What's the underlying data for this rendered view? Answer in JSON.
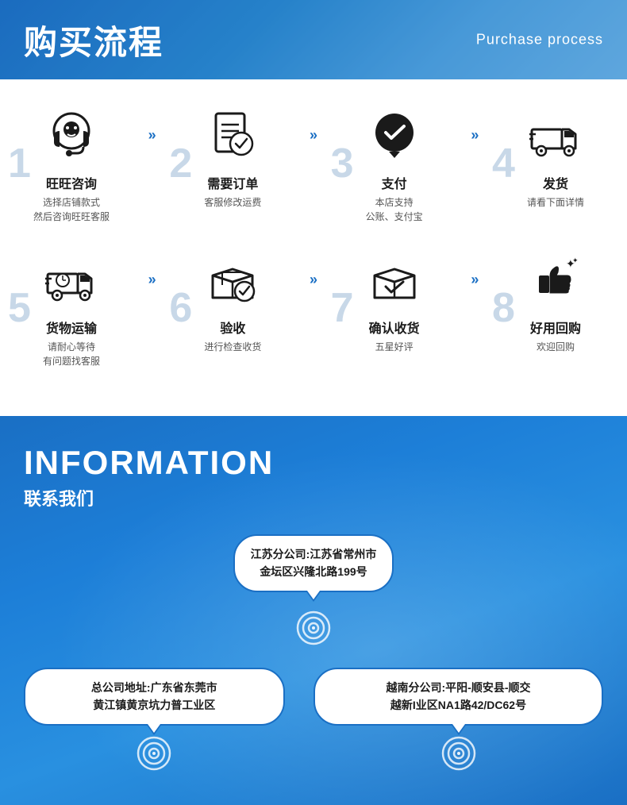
{
  "header": {
    "title_cn": "购买流程",
    "title_en": "Purchase process",
    "bg_color": "#1a7cd4"
  },
  "steps_row1": [
    {
      "number": "1",
      "title": "旺旺咨询",
      "desc": "选择店铺款式\n然后咨询旺旺客服",
      "icon": "headset"
    },
    {
      "number": "2",
      "title": "需要订单",
      "desc": "客服修改运费",
      "icon": "document"
    },
    {
      "number": "3",
      "title": "支付",
      "desc": "本店支持\n公账、支付宝",
      "icon": "chat-check"
    },
    {
      "number": "4",
      "title": "发货",
      "desc": "请看下面详情",
      "icon": "delivery"
    }
  ],
  "steps_row2": [
    {
      "number": "5",
      "title": "货物运输",
      "desc": "请耐心等待\n有问题找客服",
      "icon": "truck-clock"
    },
    {
      "number": "6",
      "title": "验收",
      "desc": "进行检查收货",
      "icon": "box-check"
    },
    {
      "number": "7",
      "title": "确认收货",
      "desc": "五星好评",
      "icon": "box-tick"
    },
    {
      "number": "8",
      "title": "好用回购",
      "desc": "欢迎回购",
      "icon": "thumbs-up"
    }
  ],
  "info": {
    "title_en": "INFORMATION",
    "title_cn": "联系我们",
    "bubble_center": "江苏分公司:江苏省常州市\n金坛区兴隆北路199号",
    "bubble_left": "总公司地址:广东省东莞市\n黄江镇黄京坑力普工业区",
    "bubble_right": "越南分公司:平阳-顺安县-顺交\n越新I业区NA1路42/DC62号"
  }
}
